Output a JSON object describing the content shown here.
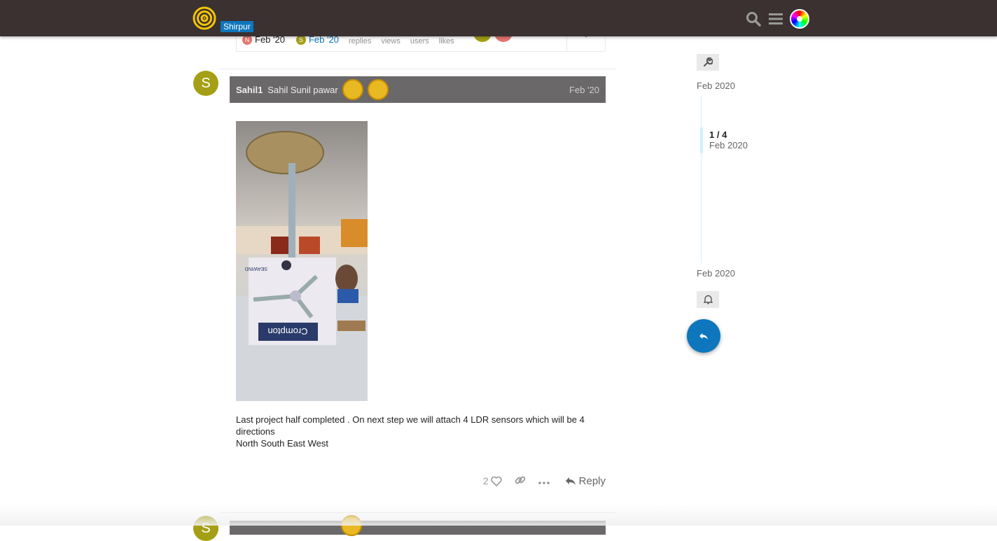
{
  "header": {
    "category": "Shirpur",
    "icons": [
      "site-logo",
      "search-icon",
      "hamburger-menu-icon",
      "user-avatar"
    ]
  },
  "topic_map": {
    "created_date": "Feb '20",
    "created_avatar": "N",
    "last_reply_date": "Feb '20",
    "last_reply_avatar": "S",
    "labels": {
      "replies": "replies",
      "views": "views",
      "users": "users",
      "likes": "likes"
    }
  },
  "post": {
    "avatar_letter": "S",
    "username": "Sahil1",
    "full_name": "Sahil Sunil pawar",
    "date": "Feb '20",
    "image_text": "Crompton",
    "image_small_text": "SEAWIND",
    "text_lines": [
      "Last project half completed . On next step we will attach 4 LDR sensors which will be 4",
      "directions",
      "North South East West"
    ],
    "like_count": "2",
    "reply_label": "Reply"
  },
  "next_post": {
    "avatar_letter": "S"
  },
  "timeline": {
    "start_date": "Feb 2020",
    "position": "1 / 4",
    "position_date": "Feb 2020",
    "end_date": "Feb 2020"
  },
  "colors": {
    "header_bg": "#3a3130",
    "accent": "#0e76bd",
    "avatar": "#a59f16"
  }
}
